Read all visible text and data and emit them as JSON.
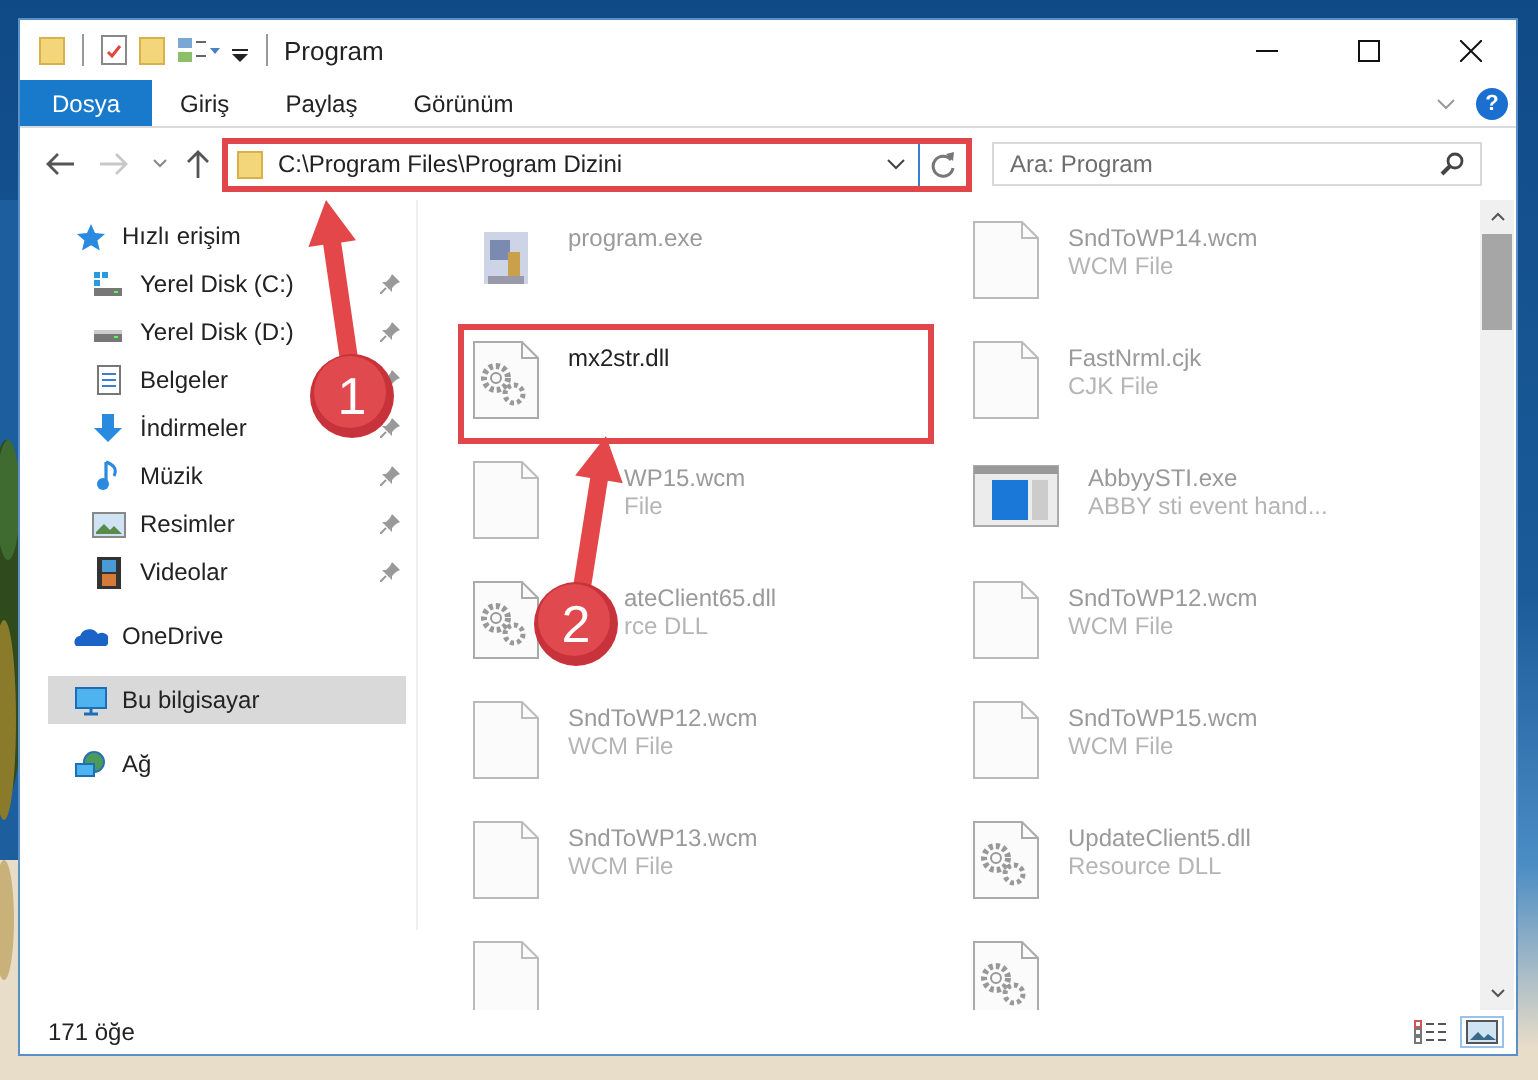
{
  "window": {
    "title": "Program"
  },
  "ribbon_tabs": [
    {
      "label": "Dosya",
      "selected": true
    },
    {
      "label": "Giriş",
      "selected": false
    },
    {
      "label": "Paylaş",
      "selected": false
    },
    {
      "label": "Görünüm",
      "selected": false
    }
  ],
  "help": "?",
  "address_bar": {
    "path": "C:\\Program Files\\Program Dizini",
    "highlighted": true
  },
  "search": {
    "placeholder": "Ara: Program"
  },
  "nav_pane": [
    {
      "label": "Hızlı erişim",
      "kind": "star",
      "selected": false,
      "children": [
        {
          "label": "Yerel Disk (C:)",
          "kind": "drive-windows",
          "pinned": true
        },
        {
          "label": "Yerel Disk (D:)",
          "kind": "drive",
          "pinned": true
        },
        {
          "label": "Belgeler",
          "kind": "documents",
          "pinned": true
        },
        {
          "label": "İndirmeler",
          "kind": "download",
          "pinned": true
        },
        {
          "label": "Müzik",
          "kind": "music",
          "pinned": true
        },
        {
          "label": "Resimler",
          "kind": "pictures",
          "pinned": true
        },
        {
          "label": "Videolar",
          "kind": "videos",
          "pinned": true
        }
      ]
    },
    {
      "label": "OneDrive",
      "kind": "cloud",
      "selected": false
    },
    {
      "label": "Bu bilgisayar",
      "kind": "computer",
      "selected": true
    },
    {
      "label": "Ağ",
      "kind": "network",
      "selected": false
    }
  ],
  "files": [
    {
      "name": "program.exe",
      "kind": "exe",
      "highlighted": false
    },
    {
      "name": "SndToWP14.wcm",
      "type": "WCM File",
      "kind": "blank",
      "highlighted": false
    },
    {
      "name": "mx2str.dll",
      "kind": "gear",
      "highlighted": true
    },
    {
      "name": "FastNrml.cjk",
      "type": "CJK File",
      "kind": "blank",
      "highlighted": false
    },
    {
      "name": "WP15.wcm",
      "type": "File",
      "kind": "blank",
      "highlighted": false,
      "covered_start": true
    },
    {
      "name": "AbbyySTI.exe",
      "type": "ABBY sti event hand...",
      "kind": "app",
      "highlighted": false
    },
    {
      "name": "ateClient65.dll",
      "type": "rce DLL",
      "kind": "gear",
      "highlighted": false,
      "covered_start": true
    },
    {
      "name": "SndToWP12.wcm",
      "type": "WCM File",
      "kind": "blank",
      "highlighted": false
    },
    {
      "name": "SndToWP12.wcm",
      "type": "WCM File",
      "kind": "blank",
      "highlighted": false
    },
    {
      "name": "SndToWP15.wcm",
      "type": "WCM File",
      "kind": "blank",
      "highlighted": false
    },
    {
      "name": "SndToWP13.wcm",
      "type": "WCM File",
      "kind": "blank",
      "highlighted": false
    },
    {
      "name": "UpdateClient5.dll",
      "type": "Resource DLL",
      "kind": "gear",
      "highlighted": false
    },
    {
      "kind": "blank",
      "highlighted": false
    },
    {
      "kind": "gear",
      "highlighted": false
    }
  ],
  "status_bar": {
    "item_count": "171 öğe",
    "views": [
      {
        "kind": "details",
        "selected": false
      },
      {
        "kind": "tiles",
        "selected": true
      }
    ]
  },
  "annotations": [
    {
      "label": "1"
    },
    {
      "label": "2"
    }
  ]
}
